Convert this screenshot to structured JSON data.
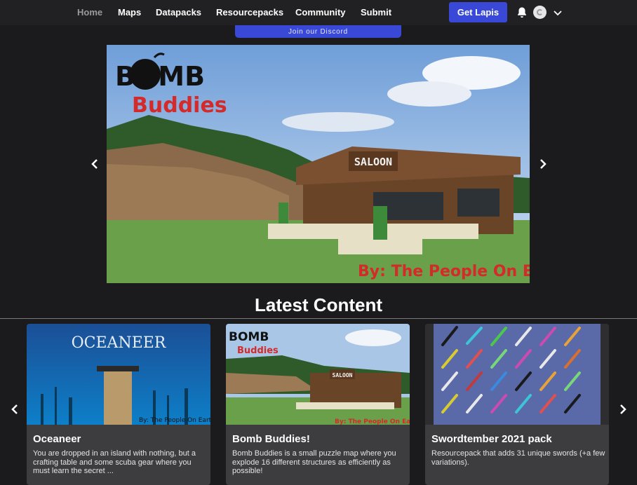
{
  "nav": {
    "links": [
      {
        "label": "Home",
        "active": true
      },
      {
        "label": "Maps"
      },
      {
        "label": "Datapacks"
      },
      {
        "label": "Resourcepacks"
      },
      {
        "label": "Community"
      },
      {
        "label": "Submit"
      }
    ],
    "cta": "Get Lapis",
    "icons": [
      "bell-icon",
      "avatar",
      "chevron-down-icon"
    ]
  },
  "banner": {
    "discord": "Join our Discord"
  },
  "hero": {
    "logo_line1": "BOMB",
    "logo_line2": "Buddies",
    "sign": "SALOON",
    "byline": "By: The People On Earth"
  },
  "latest": {
    "title": "Latest Content",
    "cards": [
      {
        "title": "Oceaneer",
        "image_text": "OCEANEER",
        "image_credit": "By: The People On Earth",
        "description": "You are dropped in an island with nothing, but a crafting table and some scuba gear where you must learn the secret ..."
      },
      {
        "title": "Bomb Buddies!",
        "image_logo1": "BOMB",
        "image_logo2": "Buddies",
        "image_sign": "SALOON",
        "image_credit": "By: The People On Earth",
        "description": "Bomb Buddies is a small puzzle map where you explode 16 different structures as efficiently as possible!"
      },
      {
        "title": "Swordtember 2021 pack",
        "description": "Resourcepack that adds 31 unique swords (+a few variations)."
      }
    ]
  },
  "colors": {
    "accent": "#3948d6",
    "background": "#1b1a1c",
    "card": "#3d3c3f",
    "logo_red": "#d42a2a"
  }
}
